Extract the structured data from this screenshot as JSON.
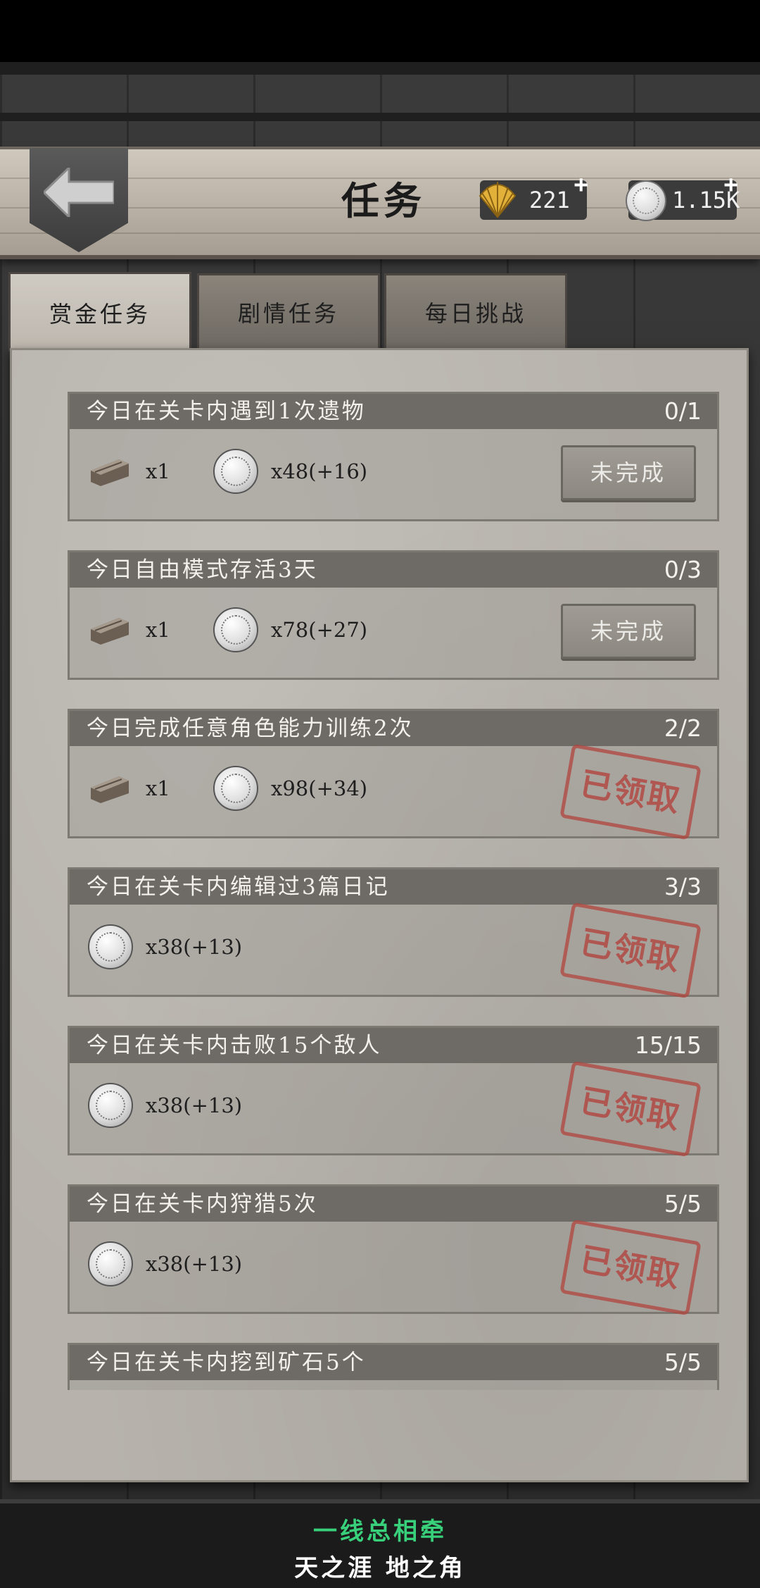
{
  "header": {
    "title": "任务",
    "shells": "221",
    "coins": "1.15K",
    "plus": "+"
  },
  "tabs": [
    {
      "label": "赏金任务",
      "active": true
    },
    {
      "label": "剧情任务",
      "active": false
    },
    {
      "label": "每日挑战",
      "active": false
    }
  ],
  "tasks": [
    {
      "name": "今日在关卡内遇到1次遗物",
      "progress": "0/1",
      "wood": "x1",
      "coins": "x48(+16)",
      "status": "未完成"
    },
    {
      "name": "今日自由模式存活3天",
      "progress": "0/3",
      "wood": "x1",
      "coins": "x78(+27)",
      "status": "未完成"
    },
    {
      "name": "今日完成任意角色能力训练2次",
      "progress": "2/2",
      "wood": "x1",
      "coins": "x98(+34)",
      "status": "已领取"
    },
    {
      "name": "今日在关卡内编辑过3篇日记",
      "progress": "3/3",
      "coins": "x38(+13)",
      "status": "已领取"
    },
    {
      "name": "今日在关卡内击败15个敌人",
      "progress": "15/15",
      "coins": "x38(+13)",
      "status": "已领取"
    },
    {
      "name": "今日在关卡内狩猎5次",
      "progress": "5/5",
      "coins": "x38(+13)",
      "status": "已领取"
    },
    {
      "name": "今日在关卡内挖到矿石5个",
      "progress": "5/5"
    }
  ],
  "subtitles": {
    "line1": "一线总相牵",
    "line2": "天之涯 地之角"
  },
  "colors": {
    "stamp": "#b2443e",
    "subtitle_green": "#38d07a"
  }
}
